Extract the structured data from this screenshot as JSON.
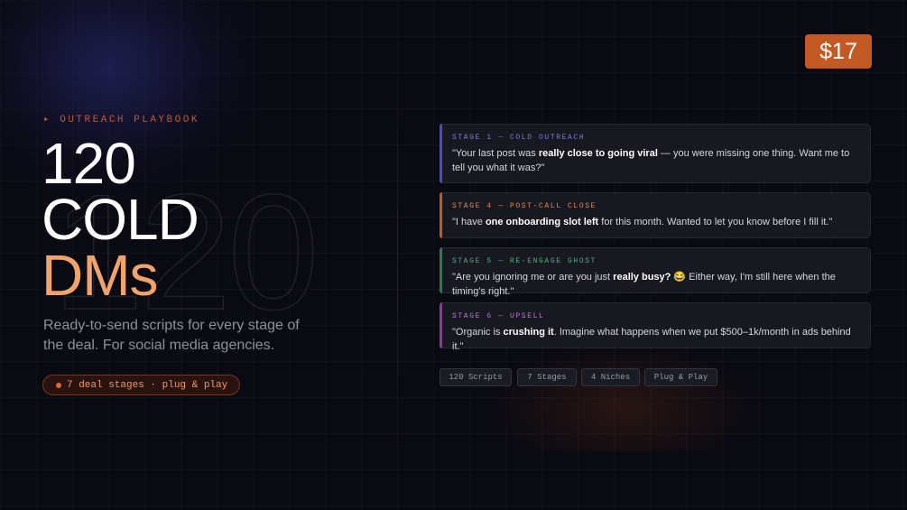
{
  "hero": {
    "eyebrow": "▸ OUTREACH PLAYBOOK",
    "ghost_number": "120",
    "headline_line1": "120",
    "headline_line2": "COLD",
    "headline_line3": "DMs",
    "subtitle": "Ready-to-send scripts for every stage of the deal. For social media agencies.",
    "pill_label": "7 deal stages · plug & play"
  },
  "price": "$17",
  "cards": [
    {
      "stage": "STAGE 1 — COLD OUTREACH",
      "quote_pre": "\"Your last post was ",
      "quote_bold": "really close to going viral",
      "quote_post": " — you were missing one thing. Want me to tell you what it was?\"",
      "accent": "#4a4ad0",
      "stage_color": "#7c7ce8"
    },
    {
      "stage": "STAGE 4 — POST-CALL CLOSE",
      "quote_pre": "\"I have ",
      "quote_bold": "one onboarding slot left",
      "quote_post": " for this month. Wanted to let you know before I fill it.\"",
      "accent": "#c35a24",
      "stage_color": "#e08a55"
    },
    {
      "stage": "STAGE 5 — RE-ENGAGE GHOST",
      "quote_pre": "\"Are you ignoring me or are you just ",
      "quote_bold": "really busy?",
      "quote_post": " 😂 Either way, I'm still here when the timing's right.\"",
      "accent": "#2e7a52",
      "stage_color": "#4fb083"
    },
    {
      "stage": "STAGE 6 — UPSELL",
      "quote_pre": "\"Organic is ",
      "quote_bold": "crushing it",
      "quote_post": ". Imagine what happens when we put $500–1k/month in ads behind it.\"",
      "accent": "#8a3aa8",
      "stage_color": "#b77ad0"
    }
  ],
  "tags": [
    "120 Scripts",
    "7 Stages",
    "4 Niches",
    "Plug & Play"
  ]
}
